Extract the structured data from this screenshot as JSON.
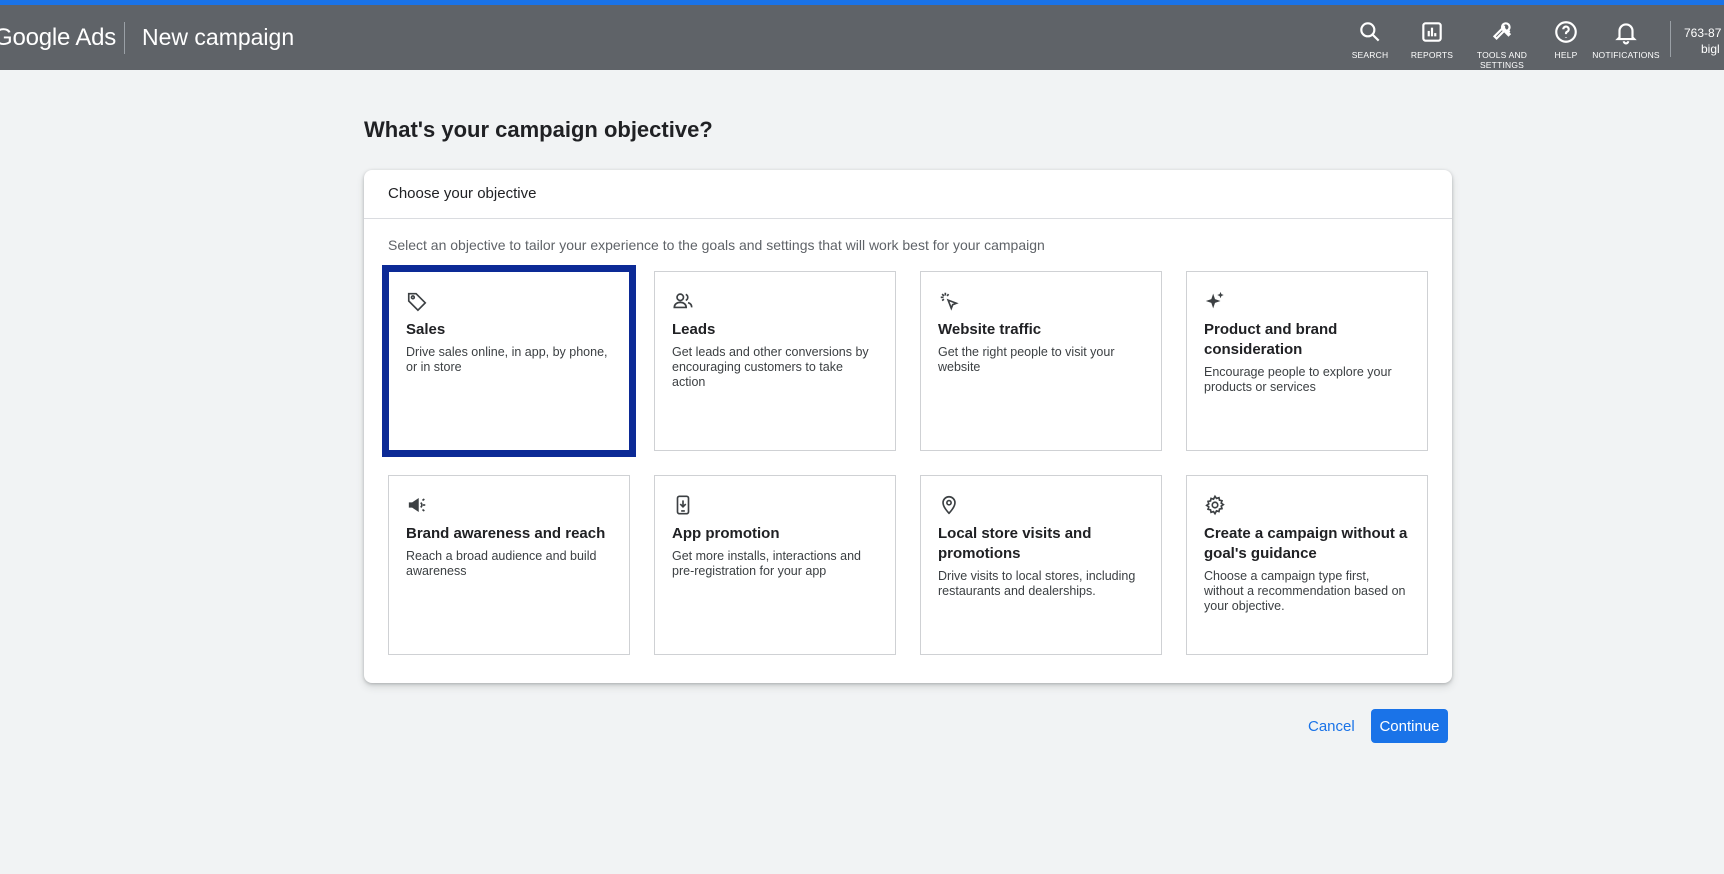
{
  "header": {
    "brand": "Google Ads",
    "page_title": "New campaign",
    "tools": [
      {
        "label": "SEARCH",
        "icon": "search-icon"
      },
      {
        "label": "REPORTS",
        "icon": "reports-icon"
      },
      {
        "label": "TOOLS AND SETTINGS",
        "icon": "wrench-icon"
      },
      {
        "label": "HELP",
        "icon": "help-icon"
      },
      {
        "label": "NOTIFICATIONS",
        "icon": "bell-icon"
      }
    ],
    "account": {
      "id": "763-87",
      "name": "bigl"
    }
  },
  "main": {
    "heading": "What's your campaign objective?",
    "card_title": "Choose your objective",
    "card_description": "Select an objective to tailor your experience to the goals and settings that will work best for your campaign",
    "objectives": [
      {
        "title": "Sales",
        "description": "Drive sales online, in app, by phone, or in store",
        "icon": "tag-icon",
        "selected": true
      },
      {
        "title": "Leads",
        "description": "Get leads and other conversions by encouraging customers to take action",
        "icon": "people-icon",
        "selected": false
      },
      {
        "title": "Website traffic",
        "description": "Get the right people to visit your website",
        "icon": "cursor-click-icon",
        "selected": false
      },
      {
        "title": "Product and brand consideration",
        "description": "Encourage people to explore your products or services",
        "icon": "sparkle-icon",
        "selected": false
      },
      {
        "title": "Brand awareness and reach",
        "description": "Reach a broad audience and build awareness",
        "icon": "megaphone-icon",
        "selected": false
      },
      {
        "title": "App promotion",
        "description": "Get more installs, interactions and pre-registration for your app",
        "icon": "phone-download-icon",
        "selected": false
      },
      {
        "title": "Local store visits and promotions",
        "description": "Drive visits to local stores, including restaurants and dealerships.",
        "icon": "location-pin-icon",
        "selected": false
      },
      {
        "title": "Create a campaign without a goal's guidance",
        "description": "Choose a campaign type first, without a recommendation based on your objective.",
        "icon": "gear-icon",
        "selected": false
      }
    ]
  },
  "footer": {
    "cancel_label": "Cancel",
    "continue_label": "Continue"
  },
  "colors": {
    "topbar": "#5f6368",
    "accent": "#1a73e8",
    "selection_outline": "#0c2a96",
    "background": "#f1f3f4"
  }
}
